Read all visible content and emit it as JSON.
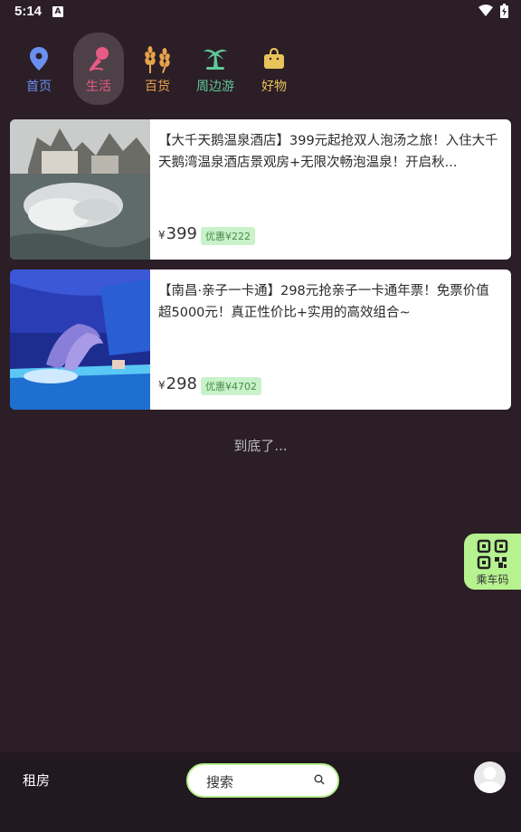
{
  "status_bar": {
    "time": "5:14",
    "a_icon": "A"
  },
  "nav": {
    "items": [
      {
        "label": "首页",
        "icon": "location-pin-icon",
        "color": "#6b8ff0"
      },
      {
        "label": "生活",
        "icon": "microphone-icon",
        "color": "#e85a86",
        "active": true
      },
      {
        "label": "百货",
        "icon": "wheat-icon",
        "color": "#e8a34a"
      },
      {
        "label": "周边游",
        "icon": "palm-tree-icon",
        "color": "#5fc89a"
      },
      {
        "label": "好物",
        "icon": "shopping-bag-icon",
        "color": "#e8c35a"
      }
    ]
  },
  "products": [
    {
      "title": "【大千天鹅温泉酒店】399元起抢双人泡汤之旅！入住大千天鹅湾温泉酒店景观房+无限次畅泡温泉！开启秋...",
      "currency": "¥",
      "price": "399",
      "discount": "优惠¥222"
    },
    {
      "title": "【南昌·亲子一卡通】298元抢亲子一卡通年票！免票价值超5000元！真正性价比+实用的高效组合~",
      "currency": "¥",
      "price": "298",
      "discount": "优惠¥4702"
    }
  ],
  "end_text": "到底了...",
  "qr_button": {
    "label": "乘车码"
  },
  "bottom_bar": {
    "rent_label": "租房",
    "search_label": "搜索"
  }
}
